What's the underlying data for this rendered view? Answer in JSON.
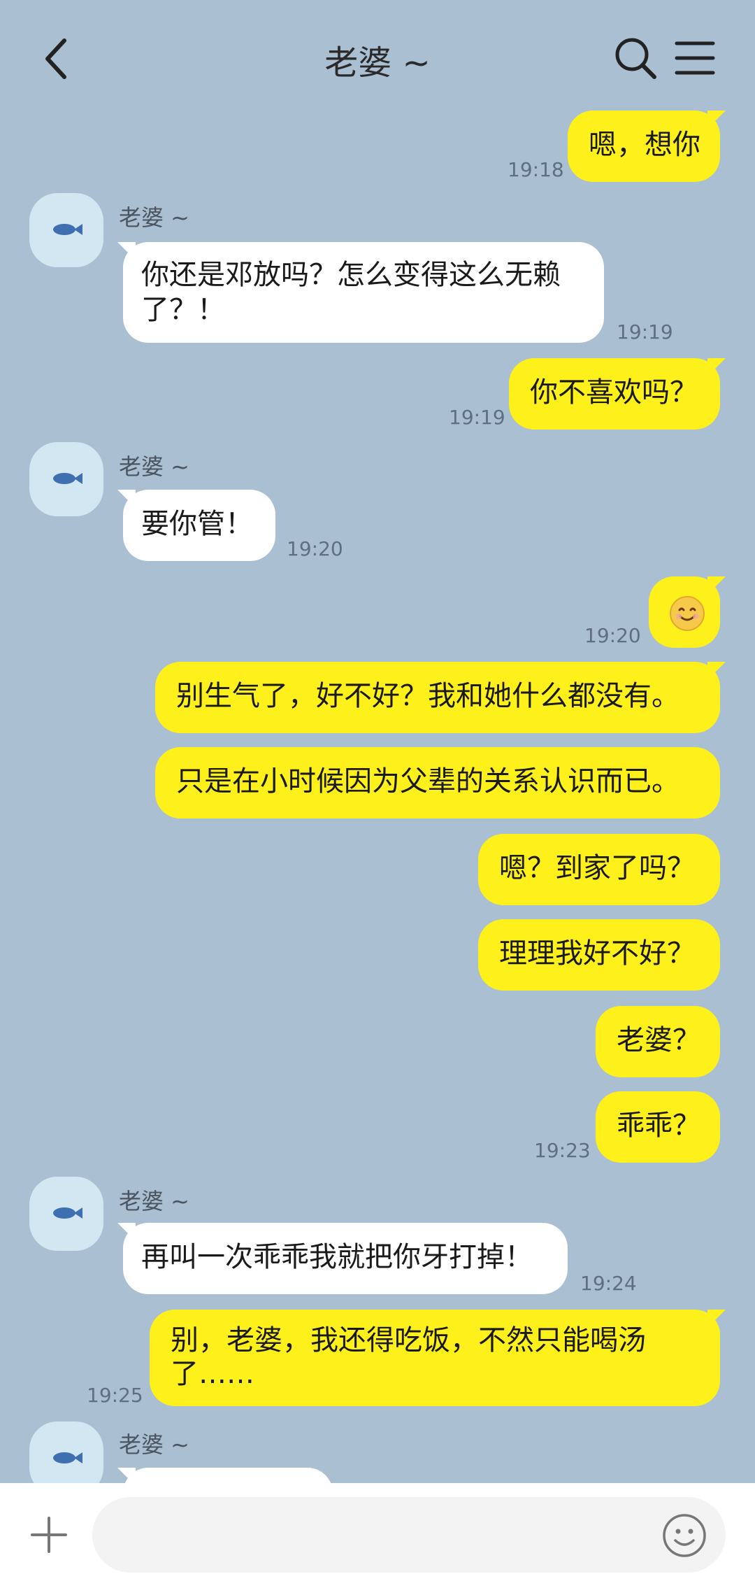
{
  "header": {
    "title": "老婆 ~"
  },
  "messages": [
    {
      "text": "嗯，想你",
      "time": "19:18"
    },
    {
      "sender": "老婆 ~",
      "line1": "你还是邓放吗？怎么变得这么无赖",
      "line2": "了？！",
      "time": "19:19"
    },
    {
      "text": "你不喜欢吗？",
      "time": "19:19"
    },
    {
      "sender": "老婆 ~",
      "text": "要你管！",
      "time": "19:20"
    },
    {
      "emoji": "smiling-face",
      "time": "19:20"
    },
    {
      "text": "别生气了，好不好？我和她什么都没有。"
    },
    {
      "text": "只是在小时候因为父辈的关系认识而已。"
    },
    {
      "text": "嗯？到家了吗？"
    },
    {
      "text": "理理我好不好？"
    },
    {
      "text": "老婆？"
    },
    {
      "text": "乖乖？",
      "time": "19:23"
    },
    {
      "sender": "老婆 ~",
      "text": "再叫一次乖乖我就把你牙打掉！",
      "time": "19:24"
    },
    {
      "line1": "别，老婆，我还得吃饭，不然只能喝汤",
      "line2": "了……",
      "time": "19:25"
    },
    {
      "sender": "老婆 ~"
    }
  ],
  "input": {
    "placeholder": ""
  },
  "colors": {
    "background": "#abbfd2",
    "my_bubble": "#fef01b",
    "their_bubble": "#ffffff"
  }
}
